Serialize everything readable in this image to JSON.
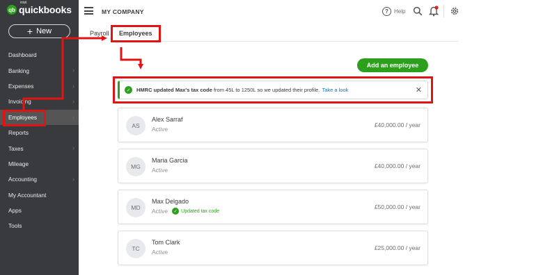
{
  "app": {
    "logo_text": "quickbooks",
    "logo_intuit": "intuit",
    "logo_mark": "qb",
    "new_button_label": "New",
    "company_name": "MY COMPANY"
  },
  "sidebar": {
    "items": [
      {
        "label": "Dashboard",
        "chevron": false,
        "active": false
      },
      {
        "label": "Banking",
        "chevron": true,
        "active": false
      },
      {
        "label": "Expenses",
        "chevron": true,
        "active": false
      },
      {
        "label": "Invoicing",
        "chevron": true,
        "active": false
      },
      {
        "label": "Employees",
        "chevron": true,
        "active": true
      },
      {
        "label": "Reports",
        "chevron": false,
        "active": false
      },
      {
        "label": "Taxes",
        "chevron": true,
        "active": false
      },
      {
        "label": "Mileage",
        "chevron": false,
        "active": false
      },
      {
        "label": "Accounting",
        "chevron": true,
        "active": false
      },
      {
        "label": "My Accountant",
        "chevron": false,
        "active": false
      },
      {
        "label": "Apps",
        "chevron": false,
        "active": false
      },
      {
        "label": "Tools",
        "chevron": false,
        "active": false
      }
    ]
  },
  "header": {
    "help_label": "Help",
    "icons": [
      "hamburger-menu-icon",
      "help-icon",
      "search-icon",
      "bell-icon",
      "gear-icon"
    ]
  },
  "tabs": {
    "payroll": "Payroll",
    "employees": "Employees"
  },
  "main": {
    "add_button_label": "Add an employee"
  },
  "notification": {
    "bold_text": "HMRC updated Max's tax code",
    "text": " from 45L to 1250L so we updated their profile.",
    "link": "Take a look",
    "close_symbol": "✕"
  },
  "employees": [
    {
      "initials": "AS",
      "name": "Alex Sarraf",
      "status": "Active",
      "salary": "£40,000.00 / year",
      "badge": ""
    },
    {
      "initials": "MG",
      "name": "Maria Garcia",
      "status": "Active",
      "salary": "£40,000.00 / year",
      "badge": ""
    },
    {
      "initials": "MD",
      "name": "Max Delgado",
      "status": "Active",
      "salary": "£50,000.00 / year",
      "badge": "Updated tax code"
    },
    {
      "initials": "TC",
      "name": "Tom Clark",
      "status": "Active",
      "salary": "£25,000.00 / year",
      "badge": ""
    }
  ],
  "colors": {
    "sidebar_bg": "#393a3d",
    "brand_green": "#2ca01c",
    "link_blue": "#0077c5",
    "annotation_red": "#e11414"
  }
}
